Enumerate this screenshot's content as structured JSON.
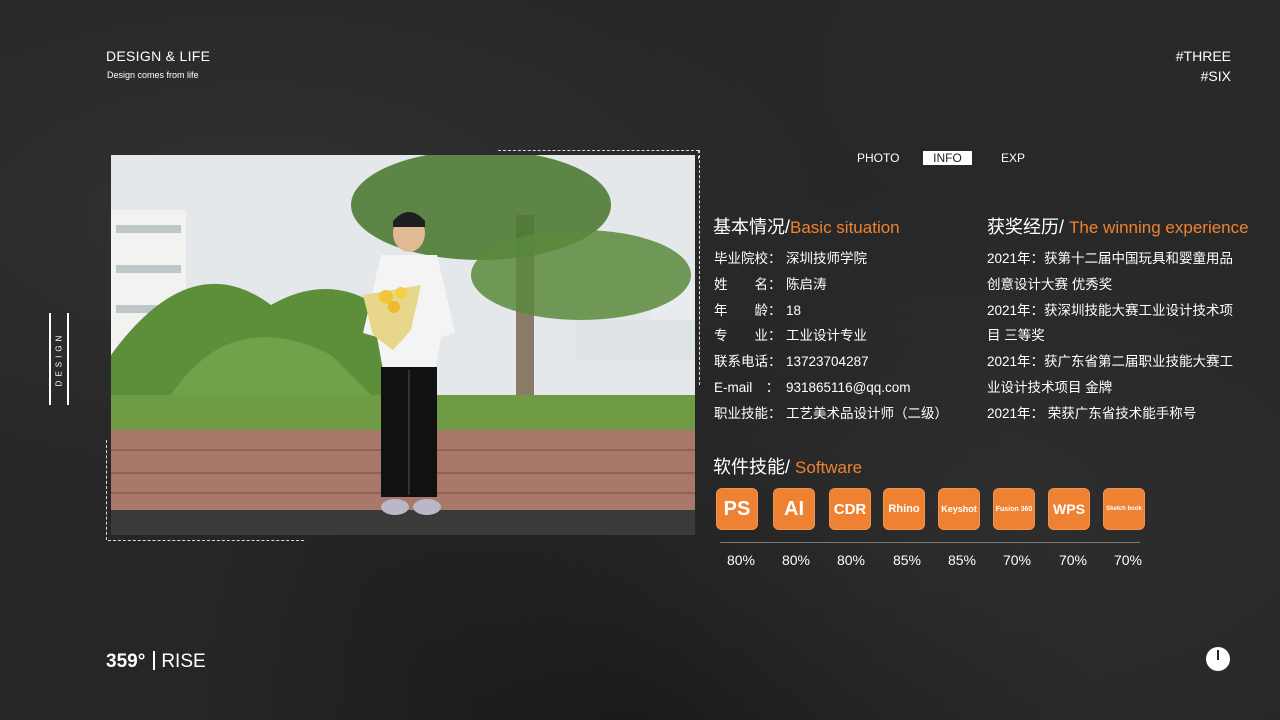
{
  "header": {
    "brand_title": "DESIGN & LIFE",
    "brand_subtitle": "Design comes from life",
    "tag_1": "#THREE",
    "tag_2": "#SIX"
  },
  "side_label": "DESIGN",
  "tabs": [
    {
      "label": "PHOTO",
      "active": false
    },
    {
      "label": "INFO",
      "active": true
    },
    {
      "label": "EXP",
      "active": false
    }
  ],
  "basic": {
    "title_cn": "基本情况/",
    "title_en": "Basic situation",
    "rows": [
      {
        "key": "毕业院校：",
        "value": "深圳技师学院"
      },
      {
        "key": "姓　　名：",
        "value": "陈启涛"
      },
      {
        "key": "年　　龄：",
        "value": "18"
      },
      {
        "key": "专　　业：",
        "value": "工业设计专业"
      },
      {
        "key": "联系电话：",
        "value": "13723704287"
      },
      {
        "key": "E-mail　：",
        "value": "931865116@qq.com"
      },
      {
        "key": "职业技能：",
        "value": "工艺美术品设计师（二级）"
      }
    ]
  },
  "awards": {
    "title_cn": "获奖经历/",
    "title_en": "The winning experience",
    "lines": [
      "2021年：获第十二届中国玩具和婴童用品",
      "创意设计大赛 优秀奖",
      "2021年：获深圳技能大赛工业设计技术项",
      "目 三等奖",
      "2021年：获广东省第二届职业技能大赛工",
      "业设计技术项目 金牌",
      "2021年： 荣获广东省技术能手称号"
    ]
  },
  "software": {
    "title_cn": "软件技能/",
    "title_en": "Software",
    "items": [
      {
        "label": "PS",
        "percent": "80%"
      },
      {
        "label": "AI",
        "percent": "80%"
      },
      {
        "label": "CDR",
        "percent": "80%"
      },
      {
        "label": "Rhino",
        "percent": "85%"
      },
      {
        "label": "Keyshot",
        "percent": "85%"
      },
      {
        "label": "Fusion 360",
        "percent": "70%"
      },
      {
        "label": "WPS",
        "percent": "70%"
      },
      {
        "label": "Sketch book",
        "percent": "70%"
      }
    ]
  },
  "footer": {
    "degree": "359°",
    "label": "RISE"
  },
  "colors": {
    "accent": "#ef8232",
    "background": "#262626",
    "text": "#ffffff"
  },
  "icons": {
    "power": "power-icon"
  }
}
